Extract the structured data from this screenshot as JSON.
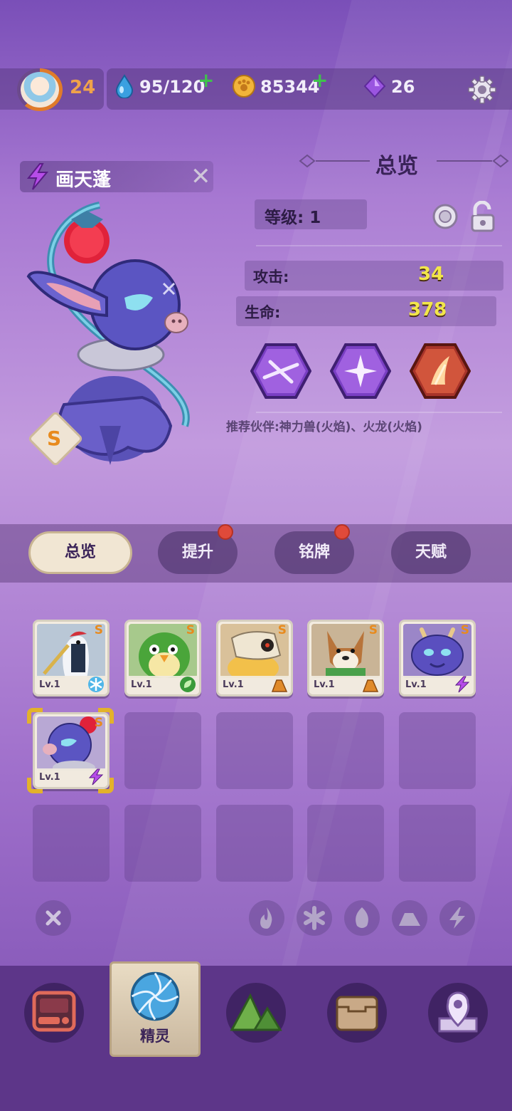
{
  "topbar": {
    "player_level": "24",
    "energy": "95/120",
    "coins": "85344",
    "gems": "26"
  },
  "pet": {
    "name": "画天蓬",
    "rank": "S",
    "element": "lightning"
  },
  "overview": {
    "title": "总览",
    "level_label": "等级:",
    "level_value": "1",
    "stats": [
      {
        "label": "攻击:",
        "value": "34"
      },
      {
        "label": "生命:",
        "value": "378"
      }
    ],
    "recommend": "推荐伙伴:神力兽(火焰)、火龙(火焰)"
  },
  "tabs": [
    {
      "label": "总览",
      "active": true,
      "badge": false
    },
    {
      "label": "提升",
      "active": false,
      "badge": true
    },
    {
      "label": "铭牌",
      "active": false,
      "badge": true
    },
    {
      "label": "天赋",
      "active": false,
      "badge": false
    }
  ],
  "collection": [
    {
      "name": "crane",
      "level": "Lv.1",
      "rank": "S",
      "element": "ice"
    },
    {
      "name": "parrot",
      "level": "Lv.1",
      "rank": "S",
      "element": "leaf"
    },
    {
      "name": "skull-beast",
      "level": "Lv.1",
      "rank": "S",
      "element": "rock"
    },
    {
      "name": "fox",
      "level": "Lv.1",
      "rank": "S",
      "element": "rock"
    },
    {
      "name": "dragon",
      "level": "Lv.1",
      "rank": "S",
      "element": "lightning"
    },
    {
      "name": "hua-tian-peng",
      "level": "Lv.1",
      "rank": "S",
      "element": "lightning"
    }
  ],
  "nav": {
    "active_label": "精灵"
  }
}
